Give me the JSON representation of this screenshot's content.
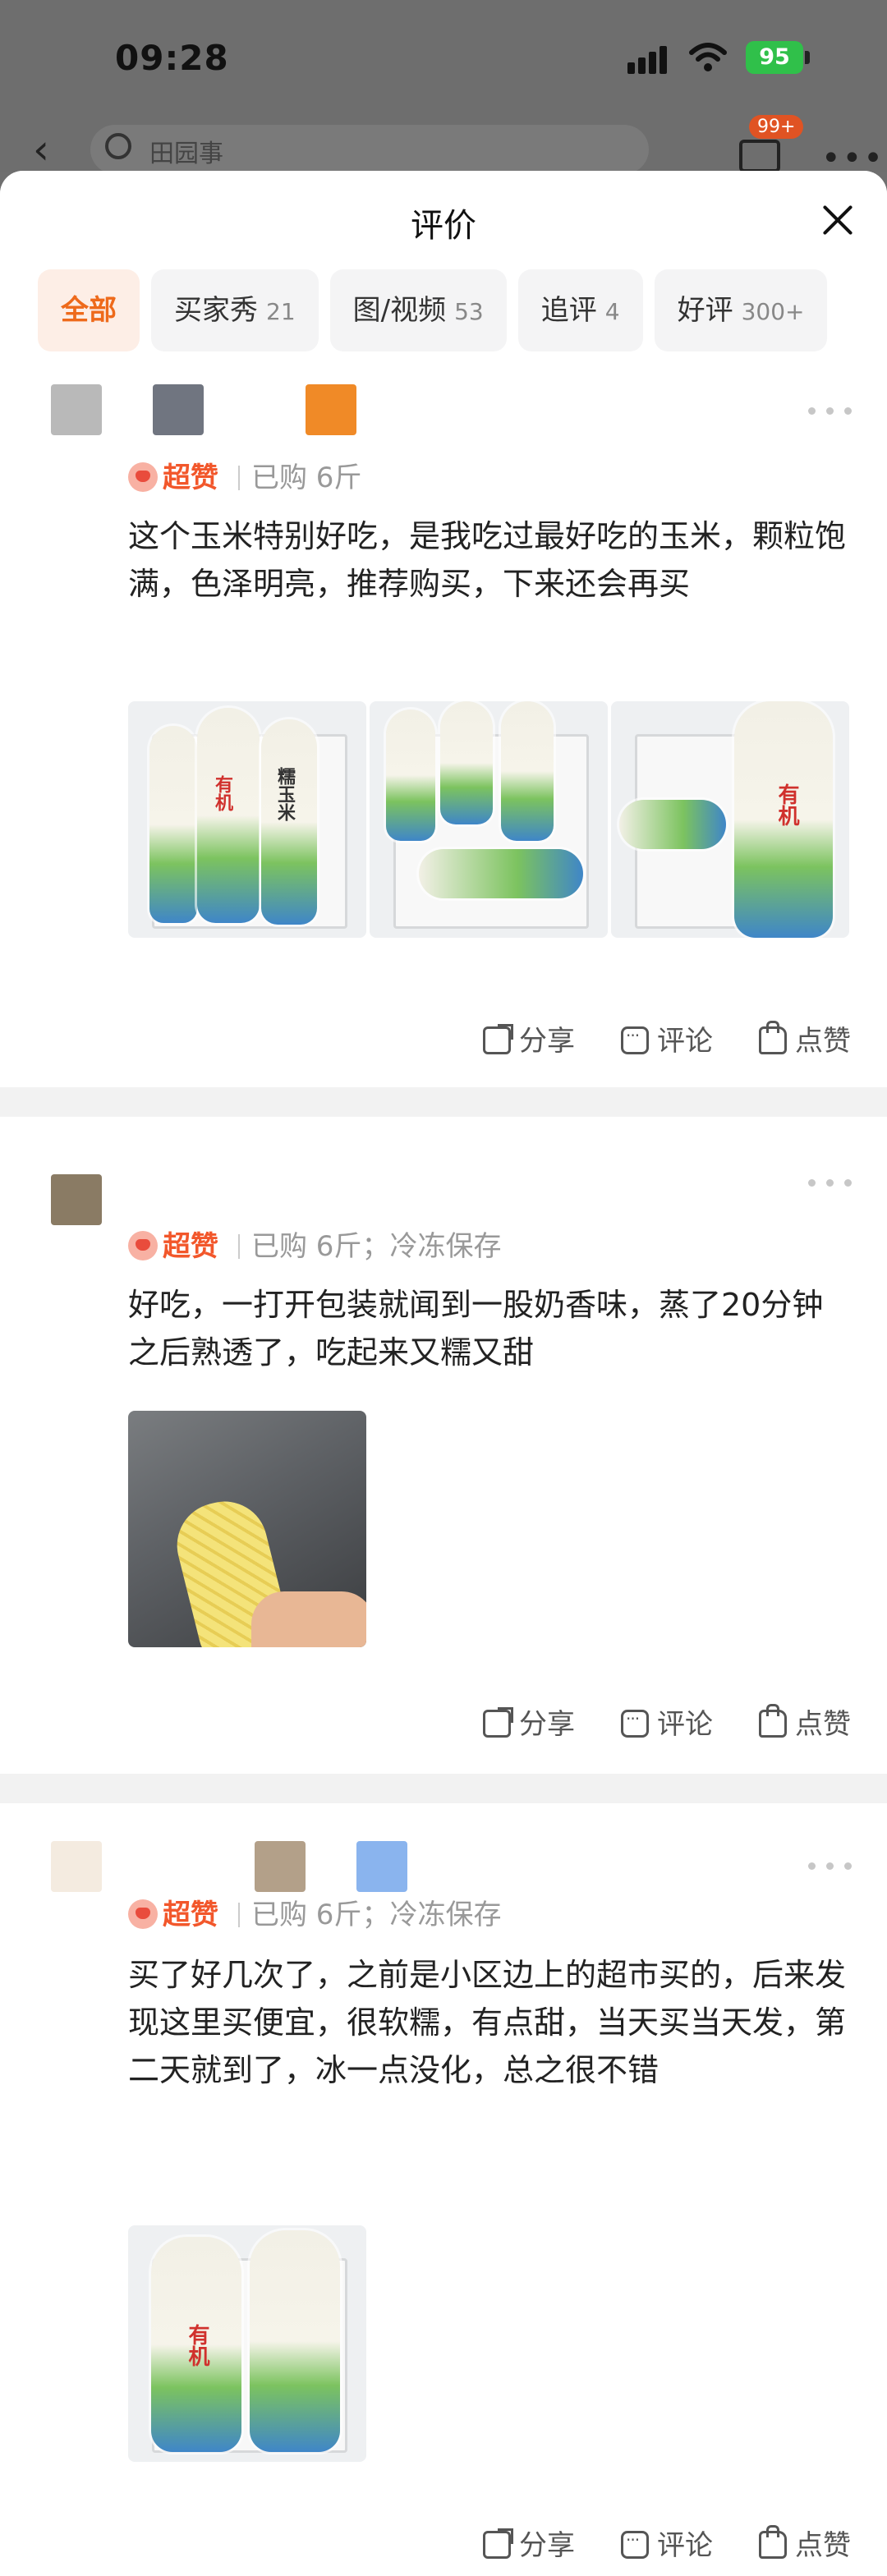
{
  "status_bar": {
    "time": "09:28",
    "battery": "95"
  },
  "background_page": {
    "search_placeholder": "田园事",
    "cart_badge": "99+"
  },
  "sheet": {
    "title": "评价"
  },
  "filters": [
    {
      "label": "全部",
      "count": ""
    },
    {
      "label": "买家秀",
      "count": "21"
    },
    {
      "label": "图/视频",
      "count": "53"
    },
    {
      "label": "追评",
      "count": "4"
    },
    {
      "label": "好评",
      "count": "300+"
    }
  ],
  "reviews": [
    {
      "badge": "超赞",
      "purchase": "已购 6斤",
      "storage": "",
      "text": "这个玉米特别好吃，是我吃过最好吃的玉米，颗粒饱满，色泽明亮，推荐购买，下来还会再买",
      "photo_labels": [
        "有机",
        "糯玉米"
      ]
    },
    {
      "badge": "超赞",
      "purchase": "已购 6斤",
      "storage": "冷冻保存",
      "text": "好吃，一打开包装就闻到一股奶香味，蒸了20分钟之后熟透了，吃起来又糯又甜"
    },
    {
      "badge": "超赞",
      "purchase": "已购 6斤",
      "storage": "冷冻保存",
      "text": "买了好几次了，之前是小区边上的超市买的，后来发现这里买便宜，很软糯，有点甜，当天买当天发，第二天就到了，冰一点没化，总之很不错"
    }
  ],
  "actions": {
    "share": "分享",
    "comment": "评论",
    "like": "点赞"
  },
  "colors": {
    "accent": "#ee6a1b",
    "badge": "#f2572b",
    "sheet_bg": "#f2f2f2"
  }
}
